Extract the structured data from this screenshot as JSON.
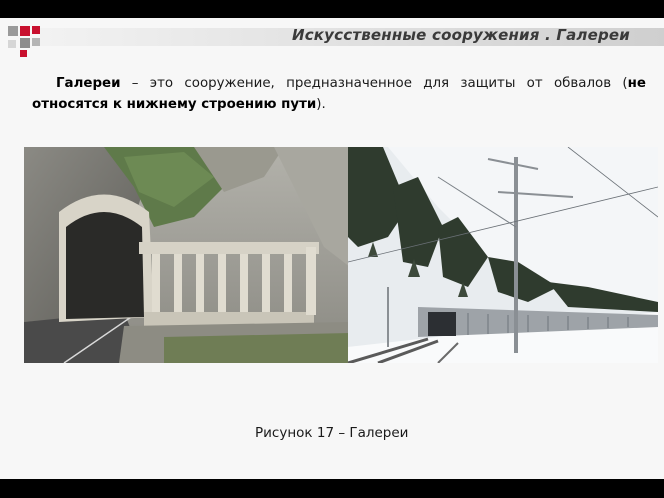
{
  "header": {
    "title": "Искусственные сооружения . Галереи"
  },
  "intro": {
    "term": "Галереи",
    "dash": " – ",
    "text": "это сооружение, предназначенное для защиты от обвалов (",
    "emphasis": "не относятся к нижнему строению пути",
    "closing": ")."
  },
  "figure": {
    "caption": "Рисунок 17 – Галереи"
  },
  "colors": {
    "page_bg": "#f7f7f7",
    "logo_red": "#c8102e",
    "logo_gray": "#8c8c8c"
  }
}
